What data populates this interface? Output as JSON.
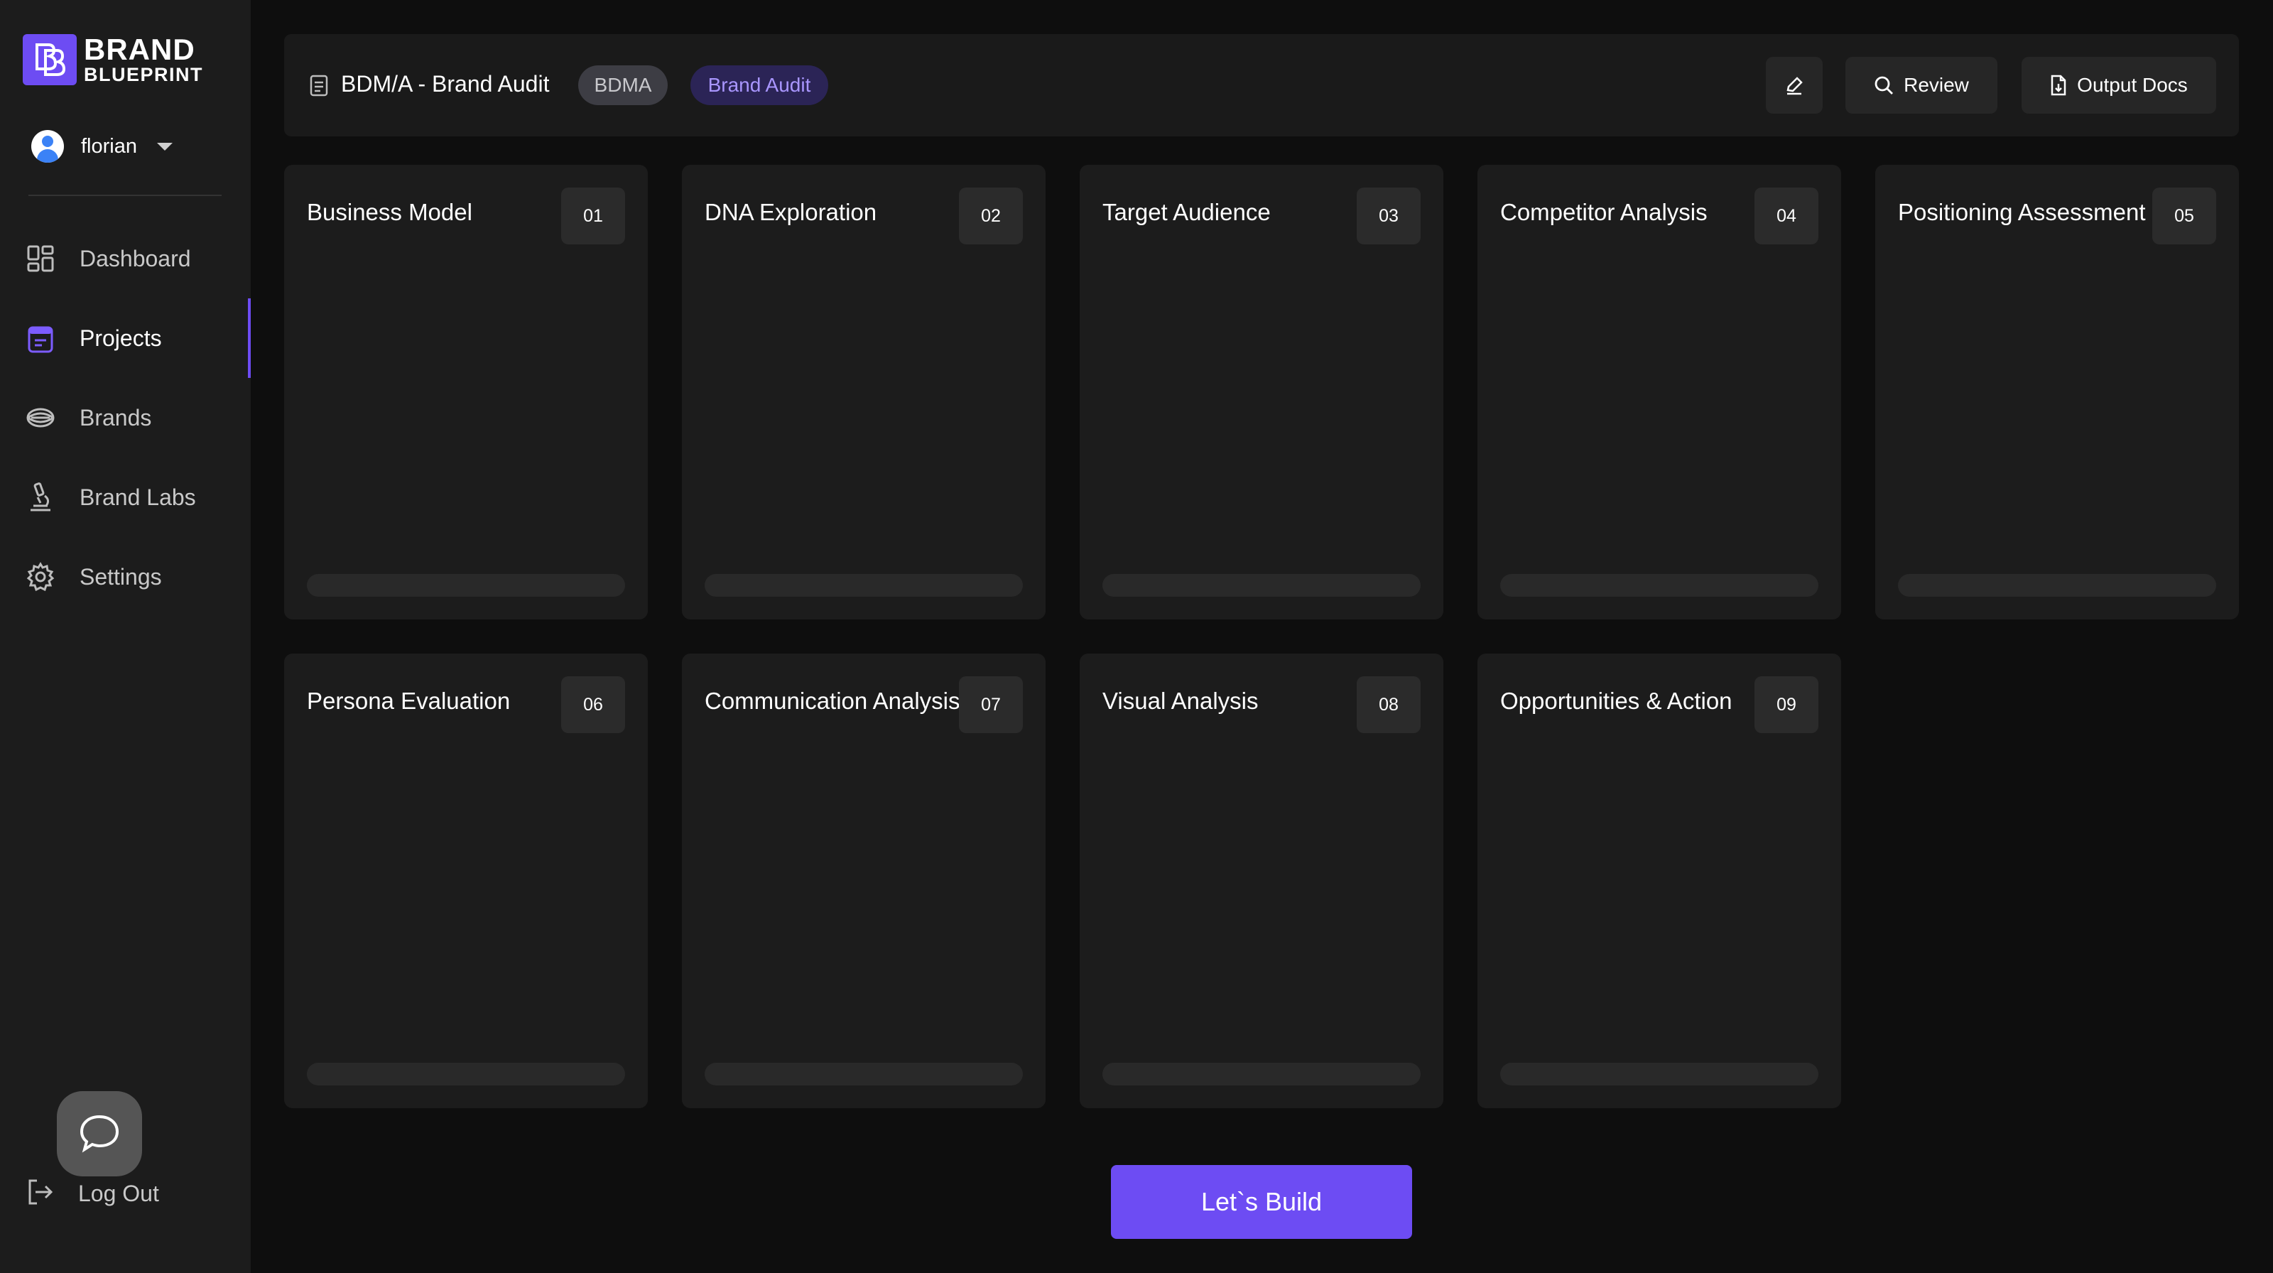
{
  "app": {
    "logo_line1": "BRAND",
    "logo_line2": "BLUEPRINT",
    "accent_color": "#6d4cf3"
  },
  "user": {
    "name": "florian"
  },
  "sidebar": {
    "items": [
      {
        "label": "Dashboard",
        "icon": "dashboard-grid-icon",
        "active": false
      },
      {
        "label": "Projects",
        "icon": "projects-doc-icon",
        "active": true
      },
      {
        "label": "Brands",
        "icon": "brands-eye-icon",
        "active": false
      },
      {
        "label": "Brand Labs",
        "icon": "microscope-icon",
        "active": false
      },
      {
        "label": "Settings",
        "icon": "gear-icon",
        "active": false
      }
    ],
    "logout_label": "Log Out"
  },
  "header": {
    "title": "BDM/A - Brand Audit",
    "tags": [
      "BDMA",
      "Brand Audit"
    ],
    "review_label": "Review",
    "output_docs_label": "Output Docs"
  },
  "cards": [
    {
      "title": "Business Model",
      "number": "01"
    },
    {
      "title": "DNA Exploration",
      "number": "02"
    },
    {
      "title": "Target Audience",
      "number": "03"
    },
    {
      "title": "Competitor Analysis",
      "number": "04"
    },
    {
      "title": "Positioning Assessment",
      "number": "05"
    },
    {
      "title": "Persona Evaluation",
      "number": "06"
    },
    {
      "title": "Communication Analysis",
      "number": "07"
    },
    {
      "title": "Visual Analysis",
      "number": "08"
    },
    {
      "title": "Opportunities & Action",
      "number": "09"
    }
  ],
  "cta_label": "Let`s Build"
}
